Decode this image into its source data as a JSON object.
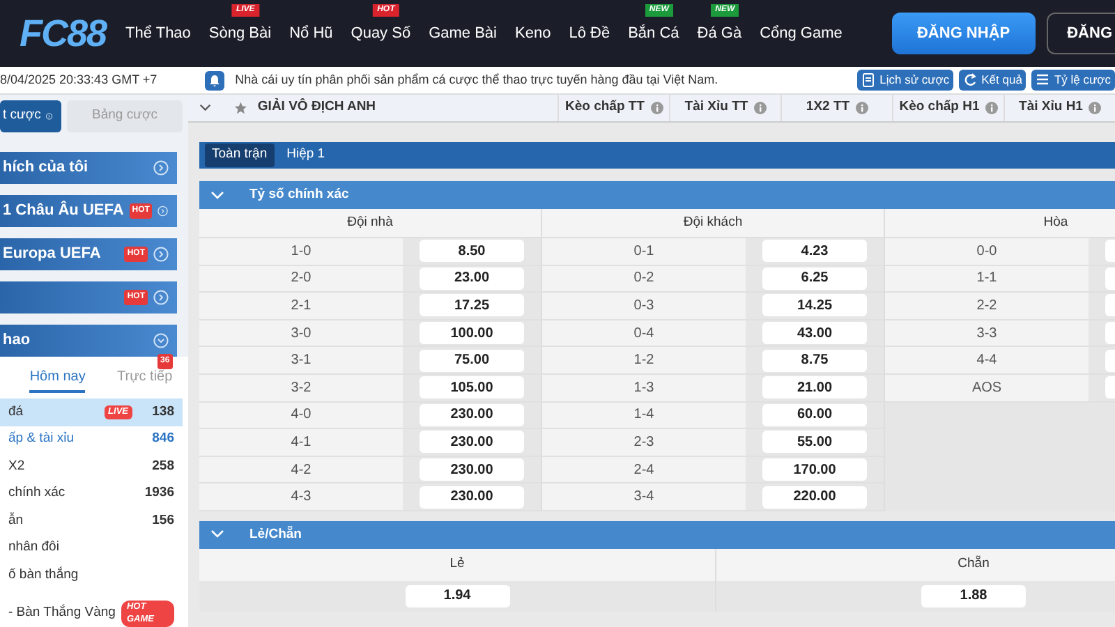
{
  "header": {
    "logo": "FC88",
    "nav": [
      {
        "label": "Thể Thao"
      },
      {
        "label": "Sòng Bài",
        "badge": {
          "text": "LIVE",
          "kind": "red"
        }
      },
      {
        "label": "Nổ Hũ"
      },
      {
        "label": "Quay Số",
        "badge": {
          "text": "HOT",
          "kind": "red"
        }
      },
      {
        "label": "Game Bài"
      },
      {
        "label": "Keno"
      },
      {
        "label": "Lô Đề"
      },
      {
        "label": "Bắn Cá",
        "badge": {
          "text": "NEW",
          "kind": "green"
        }
      },
      {
        "label": "Đá Gà",
        "badge": {
          "text": "NEW",
          "kind": "green"
        }
      },
      {
        "label": "Cổng Game"
      }
    ],
    "buttons": [
      {
        "label": "ĐĂNG NHẬP",
        "kind": "primary"
      },
      {
        "label": "ĐĂNG",
        "kind": "outline"
      }
    ]
  },
  "ticker": {
    "datetime": "8/04/2025 20:33:43 GMT +7",
    "message": "Nhà cái uy tín phân phối sản phẩm cá cược thể thao trực tuyến hàng đầu tại Việt Nam.",
    "buttons": [
      {
        "label": "Lịch sử cược",
        "kind": "history"
      },
      {
        "label": "Kết quả",
        "kind": "results"
      },
      {
        "label": "Tỷ lệ cược",
        "kind": "odds"
      }
    ]
  },
  "sidebar": {
    "tabs": [
      {
        "label": "t cược",
        "selected": true
      },
      {
        "label": "Bảng cược",
        "selected": false
      }
    ],
    "leagues": [
      {
        "label": "hích của tôi",
        "expanded": false
      },
      {
        "label": "1 Châu Âu UEFA",
        "badge": "HOT",
        "expanded": false
      },
      {
        "label": "Europa UEFA",
        "badge": "HOT",
        "expanded": false
      },
      {
        "badge": "HOT",
        "expanded": false
      },
      {
        "label": "hao",
        "expanded": true
      }
    ],
    "sport_tabs": [
      {
        "label": "Hôm nay",
        "selected": true
      },
      {
        "label": "Trực tiếp",
        "selected": false,
        "badge": "36"
      }
    ],
    "sports": [
      {
        "label": "đá",
        "count": "138",
        "selected": true,
        "badge": {
          "text": "LIVE",
          "kind": "live"
        }
      },
      {
        "label": "ấp & tài xỉu",
        "count": "846",
        "selected": false,
        "highlight": true
      },
      {
        "label": "X2",
        "count": "258",
        "selected": false
      },
      {
        "label": "chính xác",
        "count": "1936",
        "selected": false
      },
      {
        "label": "ẫn",
        "count": "156",
        "selected": false
      },
      {
        "label": "nhân đôi",
        "selected": false
      },
      {
        "label": "ố bàn thắng",
        "selected": false
      },
      {
        "label": "- Bàn Thắng Vàng",
        "selected": false,
        "badge": {
          "text": "HOT GAME",
          "kind": "hotgame"
        }
      }
    ]
  },
  "league": {
    "name": "GIẢI VÔ ĐỊCH ANH",
    "columns": [
      "Kèo chấp TT",
      "Tài Xỉu TT",
      "1X2 TT",
      "Kèo chấp H1",
      "Tài Xỉu H1"
    ]
  },
  "period_tabs": [
    {
      "label": "Toàn trận",
      "selected": true
    },
    {
      "label": "Hiệp 1",
      "selected": false
    }
  ],
  "markets": [
    {
      "kind": "correct_score",
      "title": "Tỷ số chính xác",
      "groups": [
        {
          "title": "Đội nhà",
          "rows": [
            {
              "score": "1-0",
              "odds": "8.50"
            },
            {
              "score": "2-0",
              "odds": "23.00"
            },
            {
              "score": "2-1",
              "odds": "17.25"
            },
            {
              "score": "3-0",
              "odds": "100.00"
            },
            {
              "score": "3-1",
              "odds": "75.00"
            },
            {
              "score": "3-2",
              "odds": "105.00"
            },
            {
              "score": "4-0",
              "odds": "230.00"
            },
            {
              "score": "4-1",
              "odds": "230.00"
            },
            {
              "score": "4-2",
              "odds": "230.00"
            },
            {
              "score": "4-3",
              "odds": "230.00"
            }
          ]
        },
        {
          "title": "Đội khách",
          "rows": [
            {
              "score": "0-1",
              "odds": "4.23"
            },
            {
              "score": "0-2",
              "odds": "6.25"
            },
            {
              "score": "0-3",
              "odds": "14.25"
            },
            {
              "score": "0-4",
              "odds": "43.00"
            },
            {
              "score": "1-2",
              "odds": "8.75"
            },
            {
              "score": "1-3",
              "odds": "21.00"
            },
            {
              "score": "1-4",
              "odds": "60.00"
            },
            {
              "score": "2-3",
              "odds": "55.00"
            },
            {
              "score": "2-4",
              "odds": "170.00"
            },
            {
              "score": "3-4",
              "odds": "220.00"
            }
          ]
        },
        {
          "title": "Hòa",
          "rows": [
            {
              "score": "0-0"
            },
            {
              "score": "1-1"
            },
            {
              "score": "2-2"
            },
            {
              "score": "3-3"
            },
            {
              "score": "4-4"
            },
            {
              "score": "AOS"
            }
          ]
        }
      ]
    },
    {
      "kind": "odd_even",
      "title": "Lẻ/Chẵn",
      "options": [
        {
          "label": "Lẻ",
          "odds": "1.94"
        },
        {
          "label": "Chẵn",
          "odds": "1.88"
        }
      ]
    }
  ]
}
